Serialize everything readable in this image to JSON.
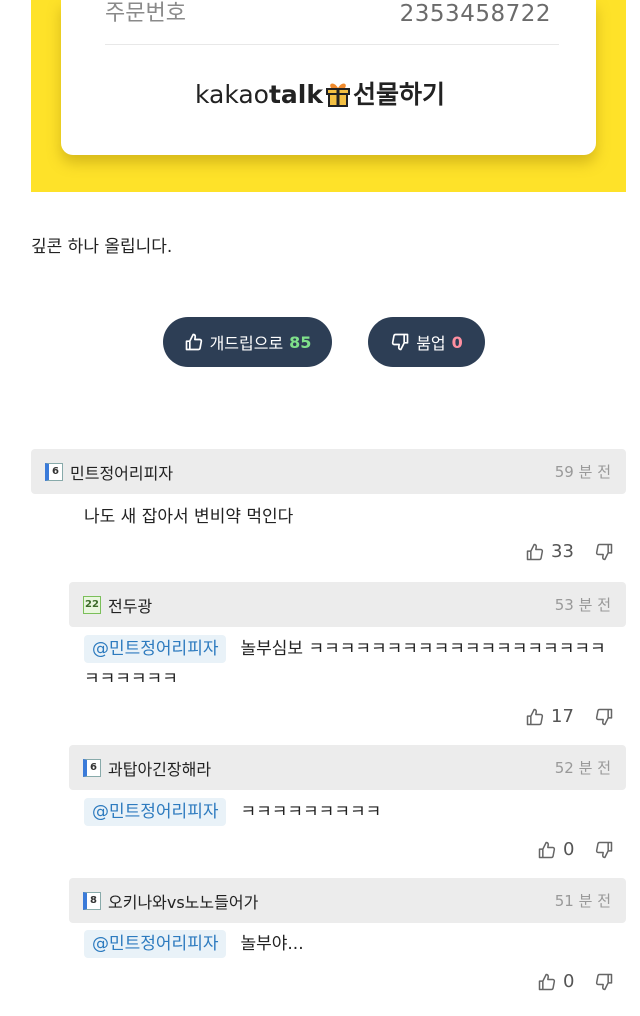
{
  "gift_card": {
    "order_label": "주문번호",
    "order_value": "2353458722",
    "brand_light": "kakao",
    "brand_bold": "talk",
    "brand_suffix": "선물하기"
  },
  "post": {
    "text": "깊콘 하나 올립니다."
  },
  "votes": {
    "up_label": "개드립으로",
    "up_count": "85",
    "down_label": "붐업",
    "down_count": "0"
  },
  "comments": [
    {
      "author": "민트정어리피자",
      "time": "59 분 전",
      "text": "나도 새 잡아서 변비약 먹인다",
      "likes": "33",
      "level": "6"
    },
    {
      "author": "전두광",
      "time": "53 분 전",
      "mention": "@민트정어리피자",
      "text": "놀부심보 ㅋㅋㅋㅋㅋㅋㅋㅋㅋㅋㅋㅋㅋㅋㅋㅋㅋㅋㅋ",
      "text2": "ㅋㅋㅋㅋㅋㅋ",
      "likes": "17",
      "level": "22"
    },
    {
      "author": "과탑아긴장해라",
      "time": "52 분 전",
      "mention": "@민트정어리피자",
      "text": "ㅋㅋㅋㅋㅋㅋㅋㅋㅋ",
      "likes": "0",
      "level": "6"
    },
    {
      "author": "오키나와vs노노들어가",
      "time": "51 분 전",
      "mention": "@민트정어리피자",
      "text": "놀부야...",
      "likes": "0",
      "level": "8"
    }
  ],
  "colors": {
    "kakao_yellow": "#fee229",
    "vote_button": "#2d3e55",
    "mention_blue": "#2d7bbf"
  }
}
